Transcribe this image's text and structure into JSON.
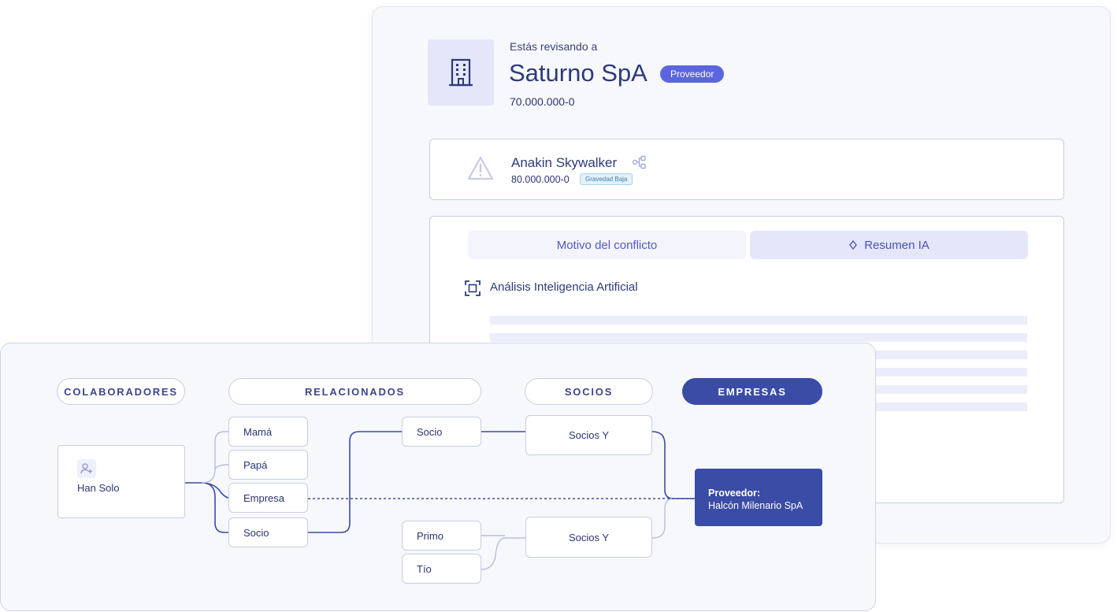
{
  "review": {
    "caption": "Estás revisando a",
    "company_name": "Saturno SpA",
    "badge": "Proveedor",
    "rut": "70.000.000-0",
    "icon": "building-icon"
  },
  "alert": {
    "icon": "warning-triangle-icon",
    "name": "Anakin Skywalker",
    "graph_icon": "relations-graph-icon",
    "rut": "80.000.000-0",
    "severity": "Gravedad Baja"
  },
  "analysis": {
    "tabs": [
      {
        "label": "Motivo del conflicto",
        "icon": null,
        "active": false
      },
      {
        "label": "Resumen IA",
        "icon": "sparkle-icon",
        "active": true
      }
    ],
    "title_icon": "scan-frame-icon",
    "title": "Análisis Inteligencia Artificial"
  },
  "graph": {
    "columns": [
      "COLABORADORES",
      "RELACIONADOS",
      "SOCIOS",
      "EMPRESAS"
    ],
    "active_column": "EMPRESAS",
    "collaborator": {
      "icon": "add-user-icon",
      "name": "Han Solo"
    },
    "related": [
      "Mamá",
      "Papá",
      "Empresa",
      "Socio"
    ],
    "partners_top": {
      "link": "Socio",
      "group": "Socios Y"
    },
    "partners_bottom": {
      "links": [
        "Primo",
        "Tío"
      ],
      "group": "Socios Y"
    },
    "company": {
      "label": "Proveedor:",
      "name": "Halcón Milenario SpA"
    },
    "colors": {
      "line": "#3a4ca5",
      "line_light": "#b9bed6",
      "active": "#3a4ca5"
    }
  }
}
